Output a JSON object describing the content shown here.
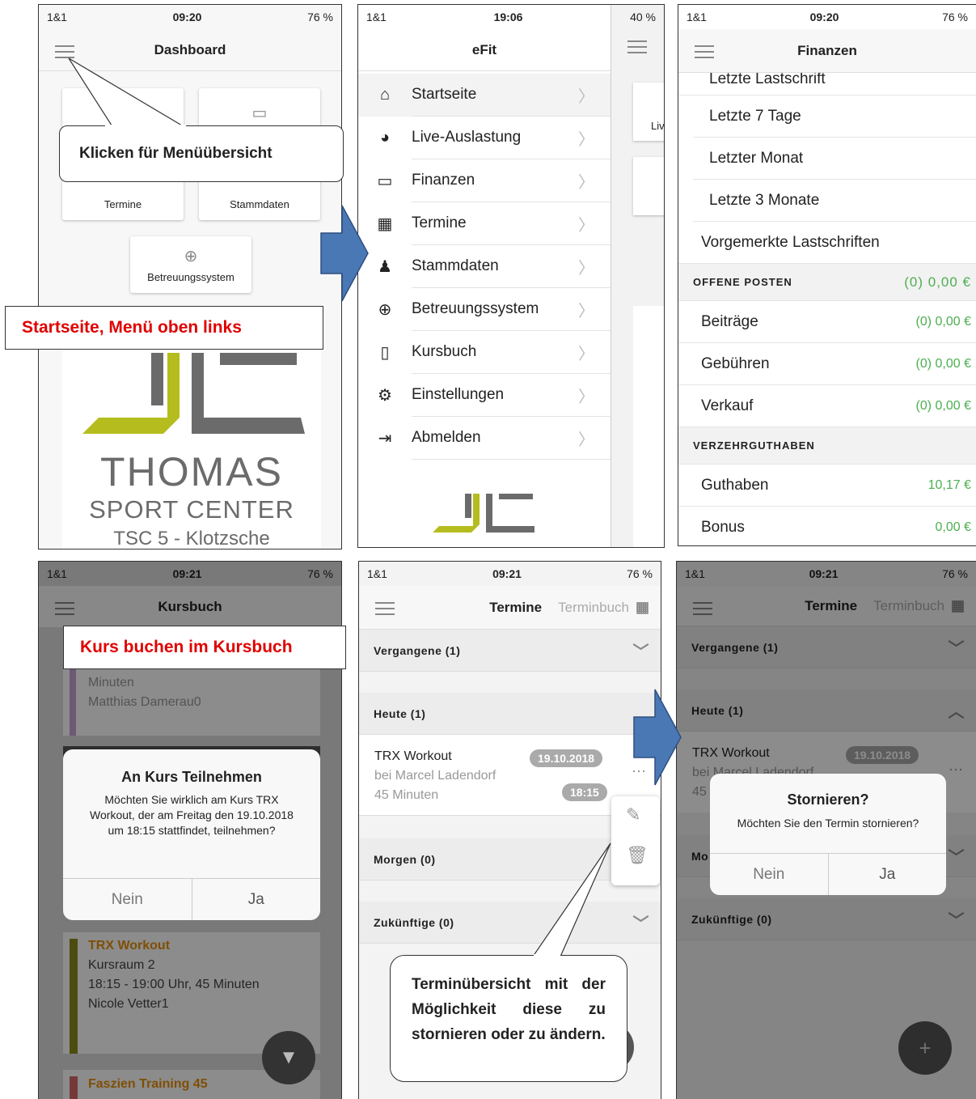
{
  "status_a": {
    "signal": "1&1",
    "time": "09:20",
    "battery": "76 %"
  },
  "status_b": {
    "signal": "1&1",
    "time": "19:06",
    "battery": "40 %"
  },
  "status_d": {
    "signal": "1&1",
    "time": "09:21",
    "battery": "76 %"
  },
  "dashboard": {
    "title": "Dashboard",
    "tiles": [
      "Termine",
      "Stammdaten",
      "Betreuungssystem"
    ],
    "callout_menu": "Klicken für Menüübersicht",
    "callout_start": "Startseite, Menü oben links",
    "logo_line1": "THOMAS",
    "logo_line2": "SPORT CENTER",
    "logo_line3": "TSC 5 - Klotzsche"
  },
  "menu": {
    "title": "eFit",
    "items": [
      {
        "label": "Startseite",
        "icon": "home-icon"
      },
      {
        "label": "Live-Auslastung",
        "icon": "pie-icon"
      },
      {
        "label": "Finanzen",
        "icon": "card-icon"
      },
      {
        "label": "Termine",
        "icon": "calendar-icon"
      },
      {
        "label": "Stammdaten",
        "icon": "person-icon"
      },
      {
        "label": "Betreuungssystem",
        "icon": "lifebuoy-icon"
      },
      {
        "label": "Kursbuch",
        "icon": "book-icon"
      },
      {
        "label": "Einstellungen",
        "icon": "gear-icon"
      },
      {
        "label": "Abmelden",
        "icon": "logout-icon"
      }
    ],
    "peek": "Liv"
  },
  "finanzen": {
    "title": "Finanzen",
    "clipped_row": "Letzte Lastschrift",
    "rows": [
      "Letzte 7 Tage",
      "Letzter Monat",
      "Letzte 3 Monate"
    ],
    "vorgemerkt": "Vorgemerkte Lastschriften",
    "offene_header": "OFFENE POSTEN",
    "offene_total": "(0) 0,00 €",
    "offene": [
      {
        "label": "Beiträge",
        "value": "(0) 0,00 €"
      },
      {
        "label": "Gebühren",
        "value": "(0) 0,00 €"
      },
      {
        "label": "Verkauf",
        "value": "(0) 0,00 €"
      }
    ],
    "verzehr_header": "VERZEHRGUTHABEN",
    "verzehr": [
      {
        "label": "Guthaben",
        "value": "10,17 €"
      },
      {
        "label": "Bonus",
        "value": "0,00 €"
      }
    ]
  },
  "kursbuch": {
    "title": "Kursbuch",
    "callout": "Kurs buchen im Kursbuch",
    "bg_item1": {
      "line1": "Minuten",
      "line2": "Matthias Damerau0"
    },
    "dialog_title": "An Kurs Teilnehmen",
    "dialog_text": "Möchten Sie wirklich am Kurs TRX Workout, der am Freitag den 19.10.2018 um 18:15 stattfindet, teilnehmen?",
    "btn_no": "Nein",
    "btn_yes": "Ja",
    "item2": {
      "title": "TRX Workout",
      "room": "Kursraum 2",
      "time": "18:15 - 19:00 Uhr, 45 Minuten",
      "trainer": "Nicole Vetter1"
    },
    "item3": {
      "title": "Faszien Training 45"
    }
  },
  "termine": {
    "title": "Termine",
    "tab2": "Terminbuch",
    "vergangene": "Vergangene (1)",
    "heute": "Heute (1)",
    "morgen": "Morgen (0)",
    "zukuenftige": "Zukünftige (0)",
    "appt": {
      "title": "TRX Workout",
      "trainer": "bei Marcel Ladendorf",
      "duration": "45 Minuten",
      "date": "19.10.2018",
      "time": "18:15"
    },
    "callout": "Terminübersicht mit der Möglichkeit diese zu stornieren oder zu ändern."
  },
  "storno": {
    "dialog_title": "Stornieren?",
    "dialog_text": "Möchten Sie den Termin stornieren?",
    "btn_no": "Nein",
    "btn_yes": "Ja",
    "trainer_partial": "bei Marcel Ladendorf",
    "dur_partial": "45",
    "morgen_partial": "Mo"
  },
  "colors": {
    "logo_green": "#b5bd1e",
    "logo_gray": "#6b6b6b",
    "arrow_blue": "#4a78b5",
    "orange": "#e8900c"
  }
}
